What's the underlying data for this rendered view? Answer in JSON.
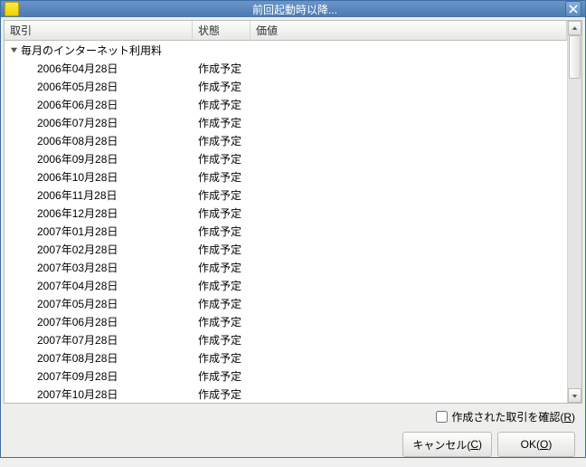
{
  "window": {
    "title": "前回起動時以降..."
  },
  "table": {
    "columns": {
      "transaction": "取引",
      "status": "状態",
      "value": "価値"
    },
    "group_label": "毎月のインターネット利用料",
    "rows": [
      {
        "date": "2006年04月28日",
        "status": "作成予定"
      },
      {
        "date": "2006年05月28日",
        "status": "作成予定"
      },
      {
        "date": "2006年06月28日",
        "status": "作成予定"
      },
      {
        "date": "2006年07月28日",
        "status": "作成予定"
      },
      {
        "date": "2006年08月28日",
        "status": "作成予定"
      },
      {
        "date": "2006年09月28日",
        "status": "作成予定"
      },
      {
        "date": "2006年10月28日",
        "status": "作成予定"
      },
      {
        "date": "2006年11月28日",
        "status": "作成予定"
      },
      {
        "date": "2006年12月28日",
        "status": "作成予定"
      },
      {
        "date": "2007年01月28日",
        "status": "作成予定"
      },
      {
        "date": "2007年02月28日",
        "status": "作成予定"
      },
      {
        "date": "2007年03月28日",
        "status": "作成予定"
      },
      {
        "date": "2007年04月28日",
        "status": "作成予定"
      },
      {
        "date": "2007年05月28日",
        "status": "作成予定"
      },
      {
        "date": "2007年06月28日",
        "status": "作成予定"
      },
      {
        "date": "2007年07月28日",
        "status": "作成予定"
      },
      {
        "date": "2007年08月28日",
        "status": "作成予定"
      },
      {
        "date": "2007年09月28日",
        "status": "作成予定"
      },
      {
        "date": "2007年10月28日",
        "status": "作成予定"
      }
    ]
  },
  "checkbox": {
    "label_pre": "作成された取引を確認(",
    "label_key": "R",
    "label_post": ")"
  },
  "buttons": {
    "cancel_pre": "キャンセル(",
    "cancel_key": "C",
    "cancel_post": ")",
    "ok_pre": "OK(",
    "ok_key": "O",
    "ok_post": ")"
  }
}
